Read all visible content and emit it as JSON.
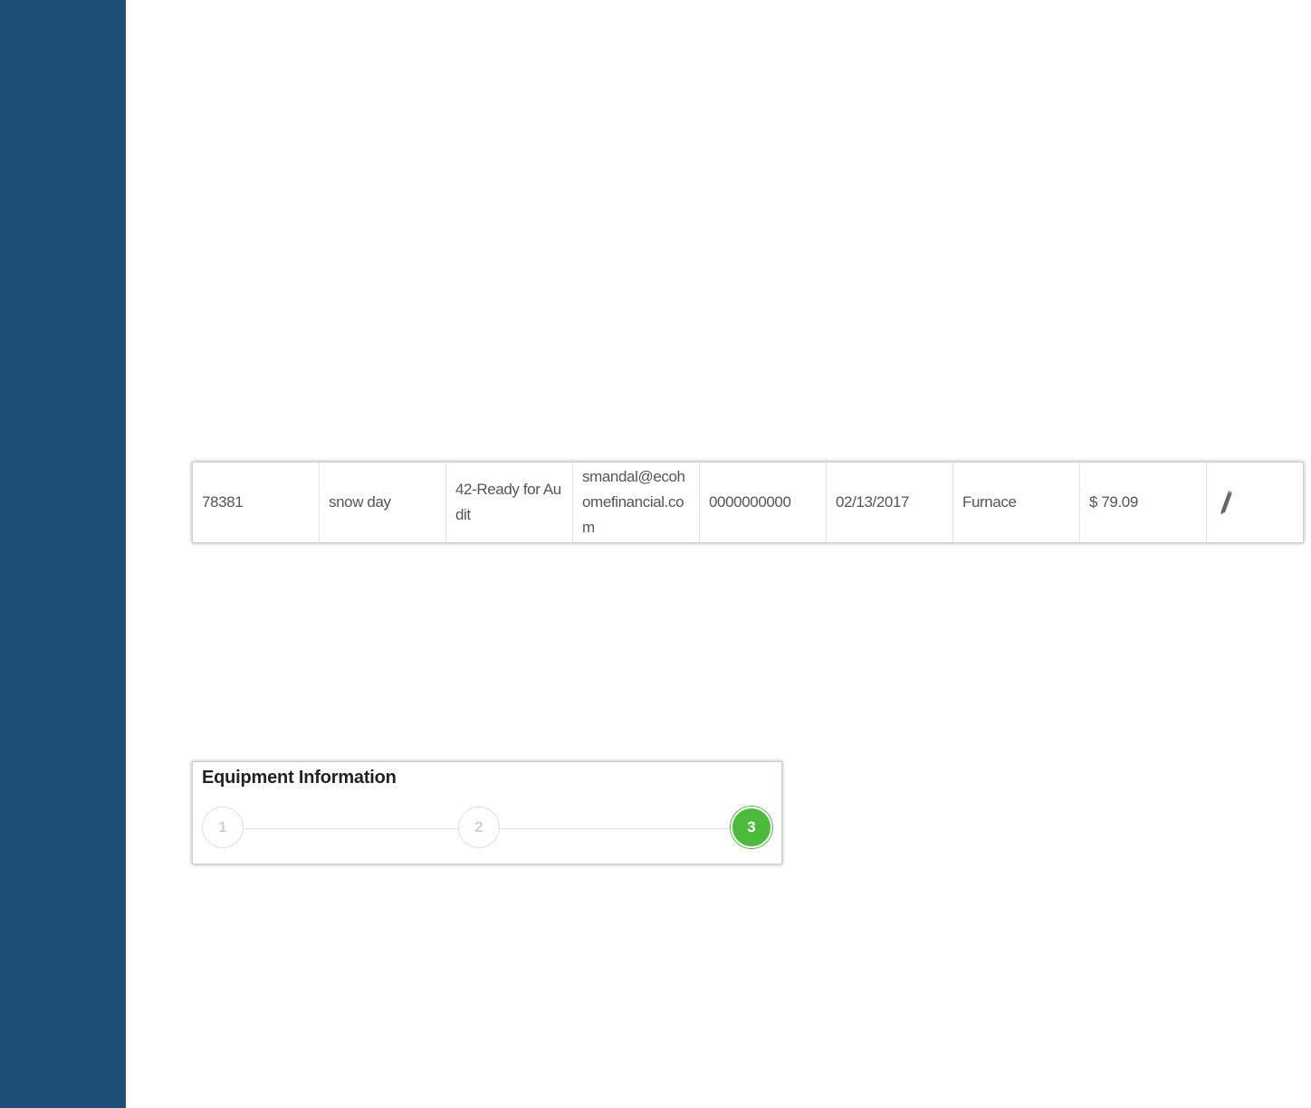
{
  "record_row": {
    "cells": [
      "78381",
      "snow day",
      "42-Ready for Audit",
      "smandal@ecohomefinancial.com",
      "0000000000",
      "02/13/2017",
      "Furnace",
      "$ 79.09"
    ],
    "edit_icon": "pencil-icon"
  },
  "equipment": {
    "title": "Equipment Information",
    "steps": [
      "1",
      "2",
      "3"
    ],
    "active_step": 3,
    "accent_color": "#4cba3a"
  },
  "colors": {
    "sidebar": "#1f4e75"
  }
}
